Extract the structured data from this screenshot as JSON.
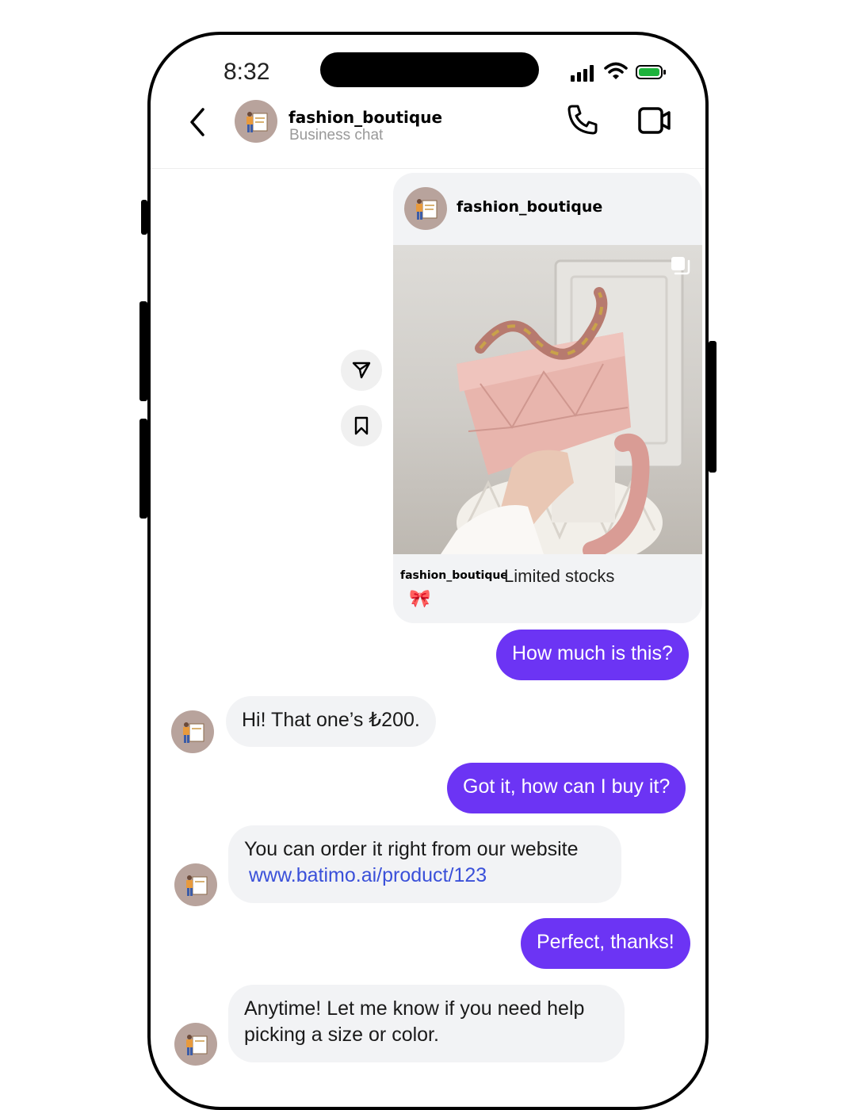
{
  "status_bar": {
    "time": "8:32"
  },
  "header": {
    "title": "fashion_boutique",
    "subtitle": "Business chat",
    "icons": [
      "back-icon",
      "phone-icon",
      "video-camera-icon"
    ]
  },
  "post": {
    "username": "fashion_boutique",
    "caption_user": "fashion_boutique",
    "caption": "Limited stocks",
    "emoji": "🎀",
    "side_actions": [
      "share-icon",
      "save-icon"
    ]
  },
  "messages": [
    {
      "from": "me",
      "text": "How much is this?"
    },
    {
      "from": "them",
      "text": "Hi! That one’s ₺200."
    },
    {
      "from": "me",
      "text": "Got it, how can I buy it?"
    },
    {
      "from": "them",
      "text": "You can order it right from our website",
      "link": "www.batimo.ai/product/123"
    },
    {
      "from": "me",
      "text": "Perfect, thanks!"
    },
    {
      "from": "them",
      "text_line1": "Anytime! Let me know if you need help",
      "text_line2": "picking a size or color."
    }
  ],
  "colors": {
    "outgoing": "#6c34f4",
    "incoming": "#f2f3f5",
    "link": "#3a50d9"
  }
}
